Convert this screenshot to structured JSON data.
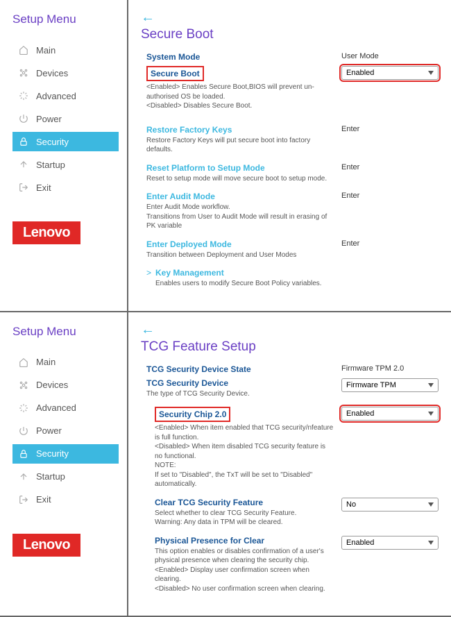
{
  "brand": "Lenovo",
  "sidebar": {
    "title": "Setup Menu",
    "items": [
      {
        "label": "Main",
        "icon": "home"
      },
      {
        "label": "Devices",
        "icon": "devices"
      },
      {
        "label": "Advanced",
        "icon": "advanced"
      },
      {
        "label": "Power",
        "icon": "power"
      },
      {
        "label": "Security",
        "icon": "security",
        "active": true
      },
      {
        "label": "Startup",
        "icon": "startup"
      },
      {
        "label": "Exit",
        "icon": "exit"
      }
    ]
  },
  "panel1": {
    "title": "Secure Boot",
    "system_mode": {
      "label": "System Mode",
      "value": "User Mode"
    },
    "secure_boot": {
      "label": "Secure Boot",
      "value": "Enabled",
      "desc": "<Enabled> Enables Secure Boot,BIOS will prevent un-authorised OS be loaded.\n<Disabled> Disables Secure Boot."
    },
    "restore_keys": {
      "label": "Restore Factory Keys",
      "action": "Enter",
      "desc": "Restore Factory Keys will put secure boot into factory defaults."
    },
    "reset_platform": {
      "label": "Reset Platform to Setup Mode",
      "action": "Enter",
      "desc": "Reset to setup mode will move secure boot to setup mode."
    },
    "audit_mode": {
      "label": "Enter Audit Mode",
      "action": "Enter",
      "desc": "Enter Audit Mode workflow.\nTransitions from User to Audit Mode will result in erasing of PK variable"
    },
    "deployed_mode": {
      "label": "Enter Deployed Mode",
      "action": "Enter",
      "desc": "Transition between Deployment and User Modes"
    },
    "key_mgmt": {
      "label": "Key Management",
      "desc": "Enables users to modify Secure Boot Policy variables."
    }
  },
  "panel2": {
    "title": "TCG Feature Setup",
    "device_state": {
      "label": "TCG Security Device State",
      "value": "Firmware TPM 2.0"
    },
    "security_device": {
      "label": "TCG Security Device",
      "value": "Firmware TPM",
      "desc": "The type of TCG Security Device."
    },
    "security_chip": {
      "label": "Security Chip 2.0",
      "value": "Enabled",
      "desc": "<Enabled> When item enabled that TCG security/nfeature is full function.\n<Disabled> When item disabled TCG security feature is no functional.\nNOTE:\nIf set to \"Disabled\", the TxT will be set to \"Disabled\" automatically."
    },
    "clear_feature": {
      "label": "Clear TCG Security Feature",
      "value": "No",
      "desc": "Select whether to clear TCG Security Feature.\nWarning: Any data in TPM will be cleared."
    },
    "physical_presence": {
      "label": "Physical Presence for Clear",
      "value": "Enabled",
      "desc": "This option enables or disables confirmation of a user's physical presence when clearing the security chip.\n<Enabled> Display user confirmation screen when clearing.\n<Disabled> No user confirmation screen when clearing."
    }
  }
}
